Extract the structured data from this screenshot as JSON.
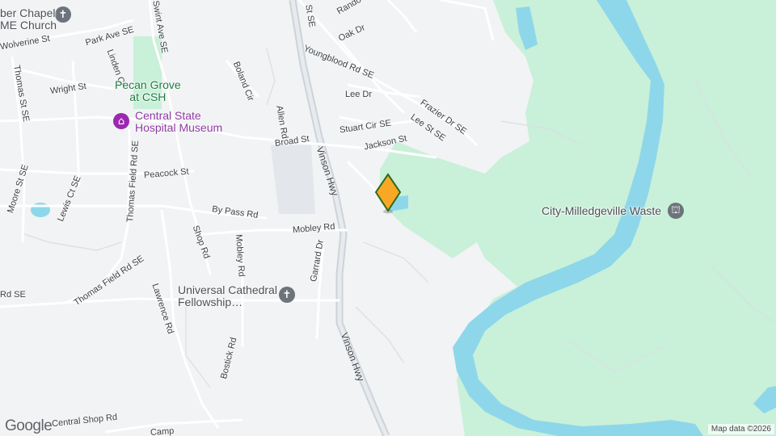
{
  "map": {
    "pois": [
      {
        "id": "chapel",
        "label": "ber Chapel\nME Church",
        "icon": "cross-icon",
        "color": "#6c737a"
      },
      {
        "id": "pecan",
        "label": "Pecan Grove\nat CSH",
        "icon": "",
        "color": "#1e7c3f"
      },
      {
        "id": "museum",
        "label": "Central State\nHospital Museum",
        "icon": "museum-icon",
        "color": "#9c27b0"
      },
      {
        "id": "cathedral",
        "label": "Universal Cathedral\nFellowship…",
        "icon": "cross-icon",
        "color": "#6c737a"
      },
      {
        "id": "waste",
        "label": "City-Milledgeville Waste",
        "icon": "landmark-icon",
        "color": "#6c737a"
      }
    ],
    "streets": [
      "St SE",
      "Rando",
      "Wolverine St",
      "Park Ave SE",
      "Swint Ave SE",
      "Linden Ct",
      "Thomas St SE",
      "Wright St",
      "Boland Cir",
      "Oak Dr",
      "Youngblood Rd SE",
      "Lee Dr",
      "Allen Rd",
      "Frazier Dr SE",
      "Stuart Cir SE",
      "Lee St SE",
      "Broad St",
      "Jackson St",
      "Vinson Hwy",
      "Moore St SE",
      "Lewis Ct SE",
      "Thomas Field Rd SE",
      "Peacock St",
      "By Pass Rd",
      "Mobley Rd",
      "Shop Rd",
      "Mobley Rd",
      "Garrard Dr",
      "Rd SE",
      "Thomas Field Rd SE",
      "Lawrence Rd",
      "Bostick Rd",
      "Vinson Hwy",
      "Central Shop Rd",
      "Camp"
    ],
    "marker_icon": "location-pin-icon",
    "marker_color": "#f9a825",
    "water_color": "#8ed7ea",
    "park_color": "#c9f0d9",
    "road_color": "#ffffff",
    "highway_color": "#cdd3da",
    "logo": "Google",
    "attribution": "Map data ©2026"
  }
}
